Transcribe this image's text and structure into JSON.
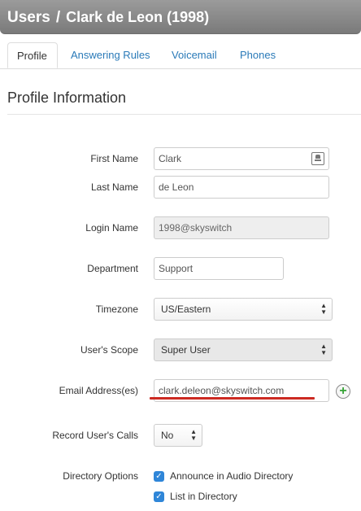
{
  "header": {
    "section": "Users",
    "separator": "/",
    "user": "Clark de Leon (1998)"
  },
  "tabs": [
    {
      "label": "Profile",
      "active": true
    },
    {
      "label": "Answering Rules",
      "active": false
    },
    {
      "label": "Voicemail",
      "active": false
    },
    {
      "label": "Phones",
      "active": false
    }
  ],
  "section_title": "Profile Information",
  "form": {
    "first_name": {
      "label": "First Name",
      "value": "Clark",
      "icon": "contact-card-icon"
    },
    "last_name": {
      "label": "Last Name",
      "value": "de Leon"
    },
    "login_name": {
      "label": "Login Name",
      "value": "1998@skyswitch"
    },
    "department": {
      "label": "Department",
      "value": "Support"
    },
    "timezone": {
      "label": "Timezone",
      "value": "US/Eastern"
    },
    "scope": {
      "label": "User's Scope",
      "value": "Super User"
    },
    "email": {
      "label": "Email Address(es)",
      "value": "clark.deleon@skyswitch.com",
      "add_icon": "plus-circle-icon",
      "highlight_color": "#cc2a22"
    },
    "record_calls": {
      "label": "Record User's Calls",
      "value": "No"
    },
    "directory": {
      "label": "Directory Options",
      "options": [
        {
          "label": "Announce in Audio Directory",
          "checked": true
        },
        {
          "label": "List in Directory",
          "checked": true
        }
      ]
    }
  },
  "colors": {
    "accent": "#2f86d8",
    "link": "#2a7ab8",
    "header_bg": "#888888",
    "add_green": "#34a334"
  }
}
